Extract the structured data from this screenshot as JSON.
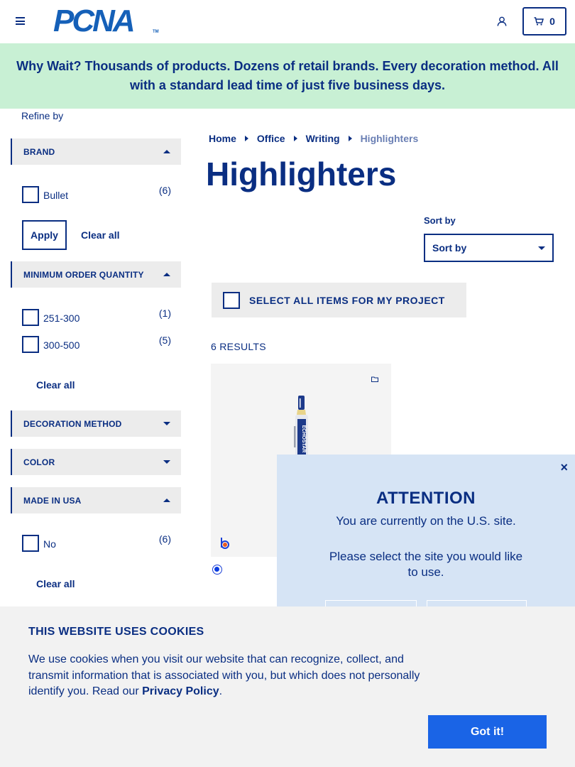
{
  "header": {
    "logo_text": "PCNA",
    "logo_tm": "TM",
    "cart_count": "0",
    "icons": [
      "hamburger-menu-icon",
      "account-icon",
      "cart-icon"
    ]
  },
  "banner": {
    "text": "Why Wait? Thousands of products. Dozens of retail brands. Every decoration method. All with a standard lead time of just five business days."
  },
  "sidebar": {
    "refine_label": "Refine by",
    "facets": {
      "brand": {
        "label": "BRAND",
        "options": [
          {
            "label": "Bullet",
            "count": "(6)"
          }
        ],
        "apply_label": "Apply",
        "clear_label": "Clear all"
      },
      "moq": {
        "label": "MINIMUM ORDER QUANTITY",
        "options": [
          {
            "label": "251-300",
            "count": "(1)"
          },
          {
            "label": "300-500",
            "count": "(5)"
          }
        ],
        "clear_label": "Clear all"
      },
      "decoration": {
        "label": "DECORATION METHOD"
      },
      "color": {
        "label": "COLOR"
      },
      "usa": {
        "label": "MADE IN USA",
        "options": [
          {
            "label": "No",
            "count": "(6)"
          }
        ],
        "clear_label": "Clear all"
      }
    }
  },
  "breadcrumb": {
    "items": [
      "Home",
      "Office",
      "Writing",
      "Highlighters"
    ]
  },
  "main": {
    "title": "Highlighters",
    "sort_label": "Sort by",
    "sort_value": "Sort by",
    "select_all_label": "SELECT ALL ITEMS FOR MY PROJECT",
    "results_label": "6 RESULTS",
    "product": {
      "imprint_text": "ECHOSTAR",
      "swatch_color": "#0a3ce0"
    }
  },
  "attention": {
    "close": "×",
    "title": "ATTENTION",
    "message": "You are currently on the U.S. site.",
    "question": "Please select the site you would like to use."
  },
  "cookie": {
    "title": "THIS WEBSITE USES COOKIES",
    "text": "We use cookies when you visit our website that can recognize, collect, and transmit information that is associated with you, but which does not personally identify you. Read our ",
    "link": "Privacy Policy",
    "period": ".",
    "button": "Got it!"
  },
  "colors": {
    "navy": "#0a2e82",
    "banner_bg": "#c8f0d4",
    "modal_bg": "#d6e4f5",
    "button_blue": "#1a64e6"
  }
}
